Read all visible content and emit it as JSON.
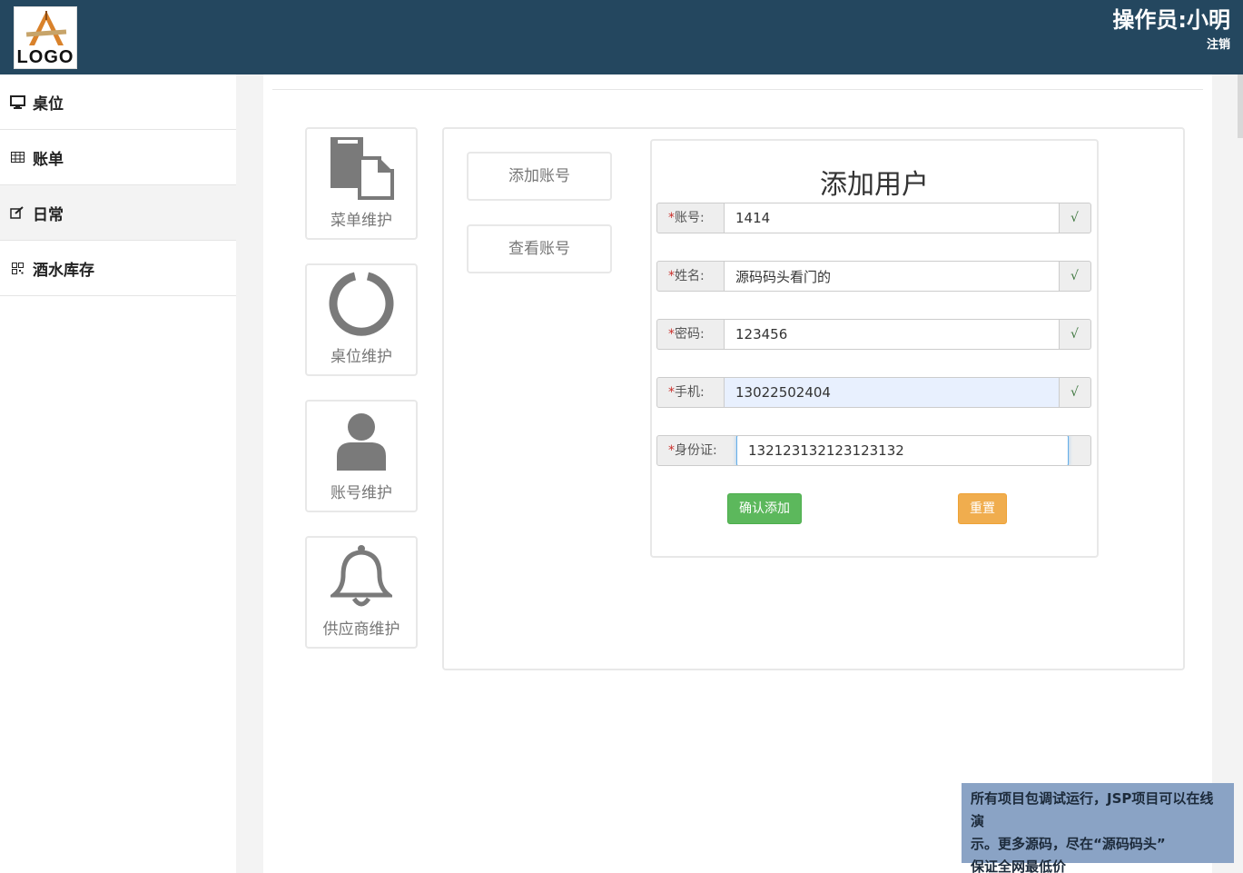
{
  "header": {
    "logo_text": "LOGO",
    "operator": "操作员:小明",
    "logout": "注销"
  },
  "sidebar": {
    "items": [
      {
        "label": "桌位",
        "icon": "monitor-icon"
      },
      {
        "label": "账单",
        "icon": "table-icon"
      },
      {
        "label": "日常",
        "icon": "edit-icon"
      },
      {
        "label": "酒水库存",
        "icon": "qrcode-icon"
      }
    ],
    "active_index": 2
  },
  "tiles": [
    {
      "label": "菜单维护",
      "icon": "copy-icon"
    },
    {
      "label": "桌位维护",
      "icon": "circle-notch-icon"
    },
    {
      "label": "账号维护",
      "icon": "user-icon"
    },
    {
      "label": "供应商维护",
      "icon": "bell-icon"
    }
  ],
  "sub_buttons": {
    "add": "添加账号",
    "view": "查看账号"
  },
  "form": {
    "title": "添加用户",
    "star": "*",
    "check": "√",
    "fields": [
      {
        "label": "账号:",
        "value": "1414"
      },
      {
        "label": "姓名:",
        "value": "源码码头看门的"
      },
      {
        "label": "密码:",
        "value": "123456"
      },
      {
        "label": "手机:",
        "value": "13022502404"
      },
      {
        "label": "身份证:",
        "value": "132123132123123132"
      }
    ],
    "submit": "确认添加",
    "reset": "重置"
  },
  "notice": {
    "line1": "所有项目包调试运行，JSP项目可以在线演",
    "line2": "示。更多源码，尽在“源码码头”",
    "line3": "保证全网最低价 www.icodedock.com"
  },
  "colors": {
    "header": "#24475f",
    "success": "#5cb85c",
    "warning": "#f0ad4e",
    "notice": "#8aa3c5"
  }
}
